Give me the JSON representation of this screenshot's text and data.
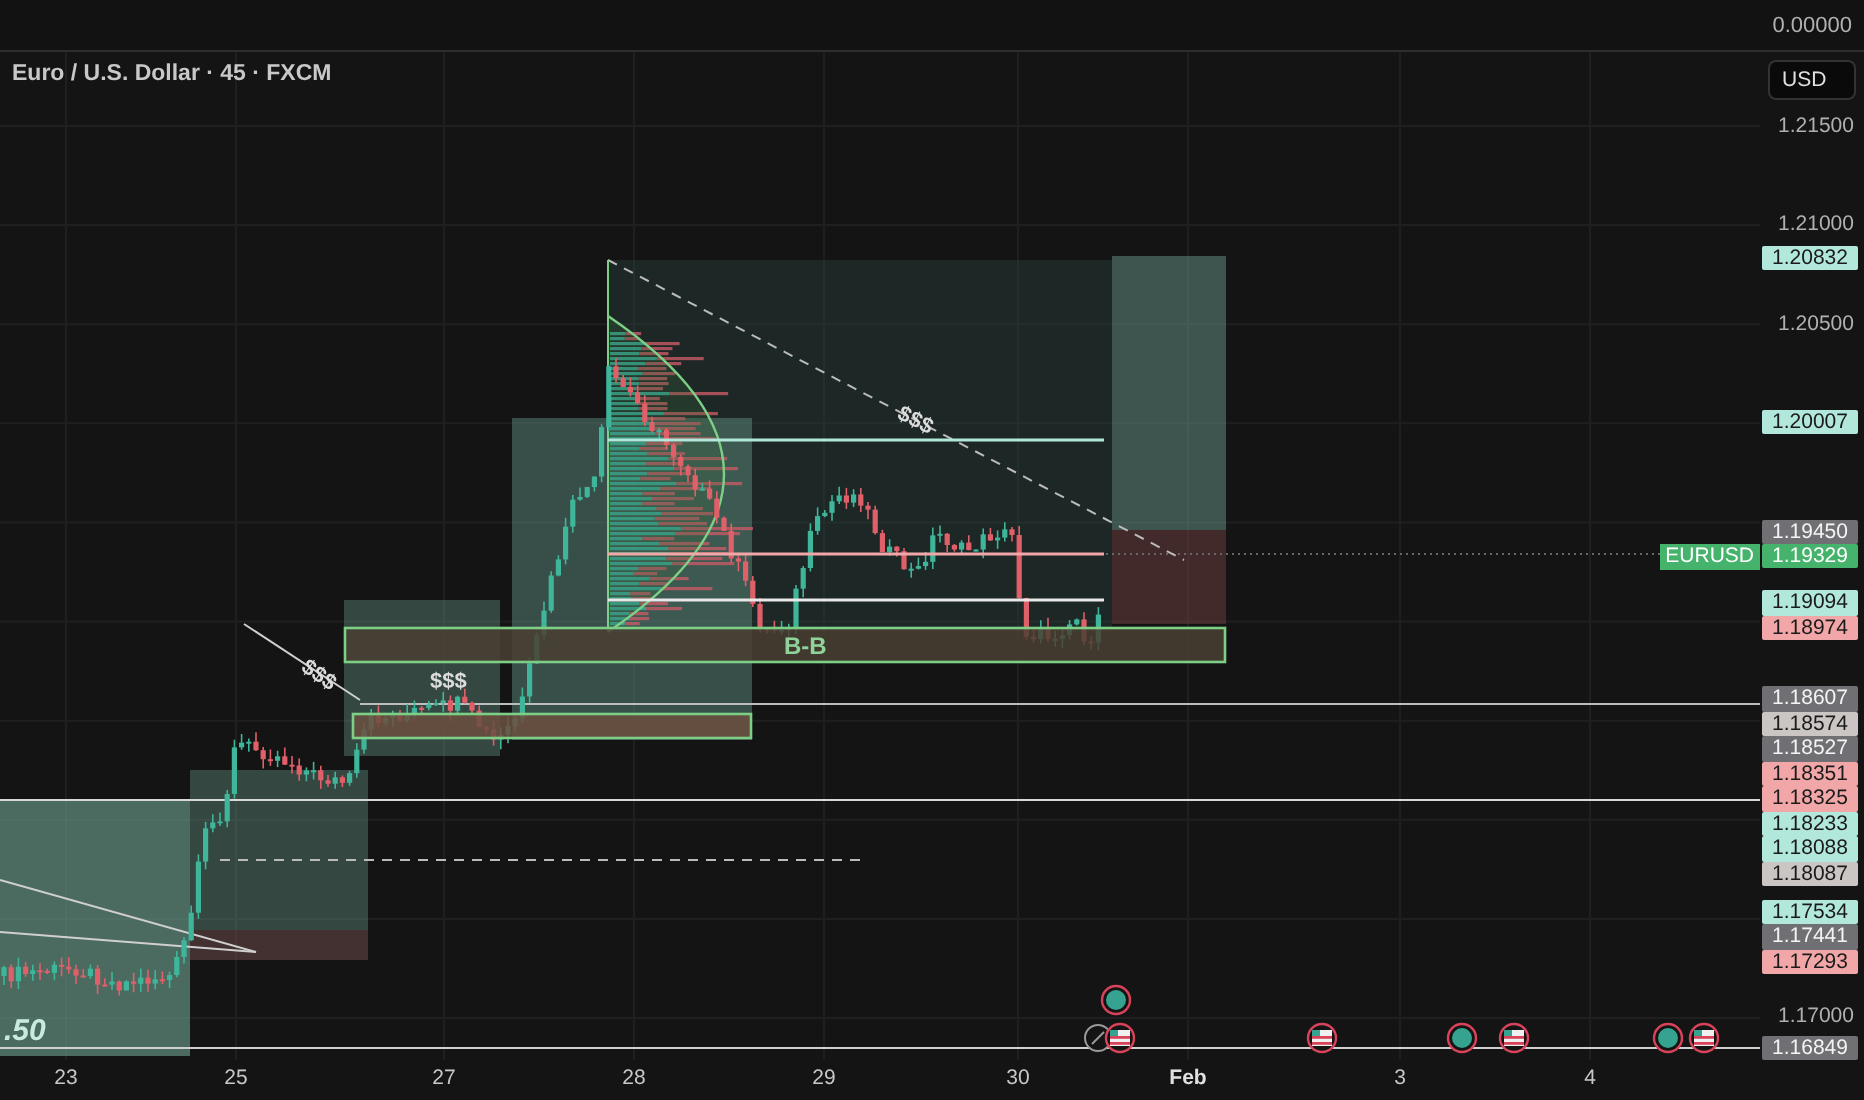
{
  "title": "Euro / U.S. Dollar · 45 · FXCM",
  "top_pane": {
    "value": "0.00000"
  },
  "currency_button": "USD",
  "price_ticks": [
    "1.21500",
    "1.21000",
    "1.20500",
    "1.17000"
  ],
  "symbol_tag": {
    "symbol": "EURUSD",
    "price": "1.19329",
    "color": "#45b36b"
  },
  "price_markers": [
    {
      "text": "1.20832",
      "color": "#b2e8dc"
    },
    {
      "text": "1.20007",
      "color": "#b2e8dc"
    },
    {
      "text": "1.19450",
      "color": "#707074"
    },
    {
      "text": "1.19094",
      "color": "#b2e8dc"
    },
    {
      "text": "1.18974",
      "color": "#f1a7a7"
    },
    {
      "text": "1.18607",
      "color": "#707074"
    },
    {
      "text": "1.18574",
      "color": "#cbc6c3"
    },
    {
      "text": "1.18527",
      "color": "#707074"
    },
    {
      "text": "1.18351",
      "color": "#f1a7a7"
    },
    {
      "text": "1.18325",
      "color": "#f1a7a7"
    },
    {
      "text": "1.18233",
      "color": "#b2e8dc"
    },
    {
      "text": "1.18088",
      "color": "#b2e8dc"
    },
    {
      "text": "1.18087",
      "color": "#cbc6c3"
    },
    {
      "text": "1.17534",
      "color": "#b2e8dc"
    },
    {
      "text": "1.17441",
      "color": "#707074"
    },
    {
      "text": "1.17293",
      "color": "#f1a7a7"
    },
    {
      "text": "1.16849",
      "color": "#707074"
    }
  ],
  "annotations": [
    {
      "text": "$$$"
    },
    {
      "text": "$$$"
    },
    {
      "text": "$$$"
    },
    {
      "text": "B-B"
    },
    {
      "text": ".50"
    }
  ],
  "dates": [
    {
      "text": "23",
      "bold": false
    },
    {
      "text": "25",
      "bold": false
    },
    {
      "text": "27",
      "bold": false
    },
    {
      "text": "28",
      "bold": false
    },
    {
      "text": "29",
      "bold": false
    },
    {
      "text": "30",
      "bold": false
    },
    {
      "text": "Feb",
      "bold": true
    },
    {
      "text": "3",
      "bold": false
    },
    {
      "text": "4",
      "bold": false
    }
  ],
  "events": [
    {
      "kind": "dot"
    },
    {
      "kind": "arrow"
    },
    {
      "kind": "flag"
    },
    {
      "kind": "flag"
    },
    {
      "kind": "dot"
    },
    {
      "kind": "flag"
    },
    {
      "kind": "dot"
    },
    {
      "kind": "flag"
    }
  ]
}
